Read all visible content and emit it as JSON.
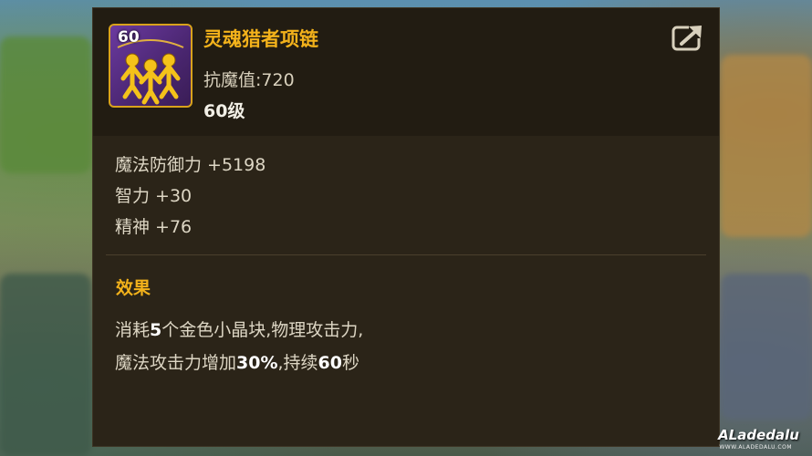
{
  "item": {
    "icon_level": "60",
    "name": "灵魂猎者项链",
    "resist": "抗魔值:720",
    "required_level": "60级"
  },
  "stats": [
    "魔法防御力 +5198",
    "智力 +30",
    "精神 +76"
  ],
  "effect": {
    "title": "效果",
    "line1_a": "消耗",
    "line1_num": "5",
    "line1_b": "个金色小晶块,物理攻击力,",
    "line2_a": "魔法攻击力增加",
    "line2_num": "30%",
    "line2_b": ",持续",
    "line2_num2": "60",
    "line2_c": "秒"
  },
  "watermark": {
    "brand": "ALadedalu",
    "sub": "WWW.ALADEDALU.COM"
  },
  "colors": {
    "panel_bg": "#2b2418",
    "header_bg": "#221c12",
    "gold": "#f3b21b",
    "text": "#ddd6c4",
    "icon_bg": "#6b3aa0"
  },
  "icons": {
    "item": "necklace-soul-hunter-icon",
    "share": "share-export-icon"
  }
}
